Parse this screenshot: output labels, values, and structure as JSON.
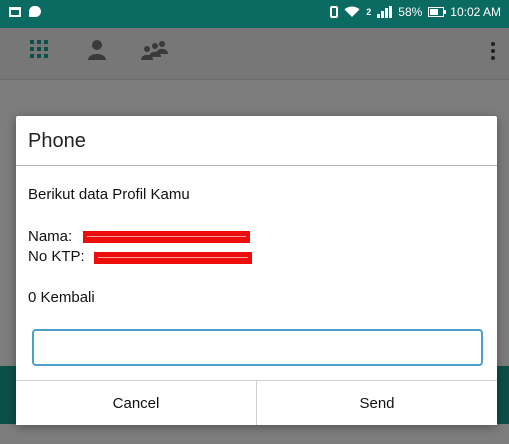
{
  "status_bar": {
    "battery": "58%",
    "time": "10:02 AM",
    "sim_label": "2",
    "icons": [
      "notification-square-icon",
      "chat-bubble-icon",
      "vibrate-icon",
      "wifi-icon",
      "signal-icon",
      "battery-icon"
    ]
  },
  "toolbar": {
    "icons": [
      "apps-grid-icon",
      "person-icon",
      "group-icon",
      "more-vert-icon"
    ]
  },
  "dialog": {
    "title": "Phone",
    "intro": "Berikut data Profil Kamu",
    "name_label": "Nama:",
    "ktp_label": "No KTP:",
    "kembali": "0 Kembali",
    "input_value": "",
    "input_placeholder": "",
    "cancel_label": "Cancel",
    "send_label": "Send"
  },
  "colors": {
    "status_bar": "#0b6a61",
    "accent_teal": "#0c4f48",
    "input_border": "#4aa0c9",
    "redaction": "#ee0d0d"
  }
}
